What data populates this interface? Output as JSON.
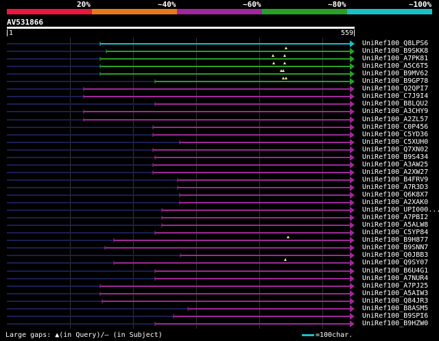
{
  "legend": {
    "items": [
      {
        "label": "20%",
        "color": "#e8193c"
      },
      {
        "label": "~40%",
        "color": "#e8781e"
      },
      {
        "label": "~60%",
        "color": "#a0289a"
      },
      {
        "label": "~80%",
        "color": "#28a028"
      },
      {
        "label": "~100%",
        "color": "#19c0c8"
      }
    ]
  },
  "query": {
    "id": "AV531866",
    "start": "1",
    "end": "559"
  },
  "hits": [
    {
      "name": "UniRef100_Q8LPS6",
      "color": "#19c0c8",
      "start": 146,
      "end": 517,
      "gap_marks": []
    },
    {
      "name": "UniRef100_B9SKK8",
      "color": "#28a028",
      "start": 155,
      "end": 517,
      "gap_marks": [
        417
      ]
    },
    {
      "name": "UniRef100_A7PK81",
      "color": "#28a028",
      "start": 146,
      "end": 517,
      "gap_marks": [
        398,
        415
      ]
    },
    {
      "name": "UniRef100_A5C6T5",
      "color": "#28a028",
      "start": 146,
      "end": 517,
      "gap_marks": [
        399,
        415
      ]
    },
    {
      "name": "UniRef100_B9MV62",
      "color": "#28a028",
      "start": 146,
      "end": 517,
      "gap_marks": [
        410,
        413
      ]
    },
    {
      "name": "UniRef100_B9GP78",
      "color": "#28a028",
      "start": 226,
      "end": 517,
      "gap_marks": [
        413,
        417
      ]
    },
    {
      "name": "UniRef100_Q2QPI7",
      "color": "#a0289a",
      "start": 122,
      "end": 517,
      "gap_marks": []
    },
    {
      "name": "UniRef100_C7J9I4",
      "color": "#a0289a",
      "start": 122,
      "end": 517,
      "gap_marks": []
    },
    {
      "name": "UniRef100_B8LQU2",
      "color": "#a0289a",
      "start": 226,
      "end": 517,
      "gap_marks": []
    },
    {
      "name": "UniRef100_A3CHY9",
      "color": "#a0289a",
      "start": 122,
      "end": 517,
      "gap_marks": []
    },
    {
      "name": "UniRef100_A2ZL57",
      "color": "#a0289a",
      "start": 122,
      "end": 517,
      "gap_marks": []
    },
    {
      "name": "UniRef100_C0P456",
      "color": "#a0289a",
      "start": 223,
      "end": 517,
      "gap_marks": []
    },
    {
      "name": "UniRef100_C5YD36",
      "color": "#a0289a",
      "start": 223,
      "end": 517,
      "gap_marks": []
    },
    {
      "name": "UniRef100_C5XUH0",
      "color": "#a0289a",
      "start": 262,
      "end": 517,
      "gap_marks": []
    },
    {
      "name": "UniRef100_Q7XN02",
      "color": "#a0289a",
      "start": 223,
      "end": 517,
      "gap_marks": []
    },
    {
      "name": "UniRef100_B9S434",
      "color": "#a0289a",
      "start": 226,
      "end": 517,
      "gap_marks": []
    },
    {
      "name": "UniRef100_A3AW25",
      "color": "#a0289a",
      "start": 223,
      "end": 517,
      "gap_marks": []
    },
    {
      "name": "UniRef100_A2XW27",
      "color": "#a0289a",
      "start": 223,
      "end": 517,
      "gap_marks": []
    },
    {
      "name": "UniRef100_B4FRV9",
      "color": "#a0289a",
      "start": 259,
      "end": 517,
      "gap_marks": []
    },
    {
      "name": "UniRef100_A7R3D3",
      "color": "#a0289a",
      "start": 259,
      "end": 517,
      "gap_marks": []
    },
    {
      "name": "UniRef100_Q6K8X7",
      "color": "#a0289a",
      "start": 262,
      "end": 517,
      "gap_marks": []
    },
    {
      "name": "UniRef100_A2XAK0",
      "color": "#a0289a",
      "start": 262,
      "end": 517,
      "gap_marks": []
    },
    {
      "name": "UniRef100_UPI000...",
      "color": "#a0289a",
      "start": 236,
      "end": 517,
      "gap_marks": []
    },
    {
      "name": "UniRef100_A7PBI2",
      "color": "#a0289a",
      "start": 236,
      "end": 517,
      "gap_marks": []
    },
    {
      "name": "UniRef100_A5ALW8",
      "color": "#a0289a",
      "start": 236,
      "end": 517,
      "gap_marks": []
    },
    {
      "name": "UniRef100_C5YP84",
      "color": "#a0289a",
      "start": 226,
      "end": 517,
      "gap_marks": []
    },
    {
      "name": "UniRef100_B9H877",
      "color": "#a0289a",
      "start": 166,
      "end": 517,
      "gap_marks": [
        420
      ]
    },
    {
      "name": "UniRef100_B9SNN7",
      "color": "#a0289a",
      "start": 153,
      "end": 517,
      "gap_marks": []
    },
    {
      "name": "UniRef100_Q0JBB3",
      "color": "#a0289a",
      "start": 263,
      "end": 517,
      "gap_marks": []
    },
    {
      "name": "UniRef100_Q9SY07",
      "color": "#a0289a",
      "start": 166,
      "end": 517,
      "gap_marks": [
        416
      ]
    },
    {
      "name": "UniRef100_B6U4G1",
      "color": "#a0289a",
      "start": 226,
      "end": 517,
      "gap_marks": []
    },
    {
      "name": "UniRef100_A7NUR4",
      "color": "#a0289a",
      "start": 226,
      "end": 517,
      "gap_marks": []
    },
    {
      "name": "UniRef100_A7PJ25",
      "color": "#a0289a",
      "start": 146,
      "end": 517,
      "gap_marks": []
    },
    {
      "name": "UniRef100_A5AIW3",
      "color": "#a0289a",
      "start": 146,
      "end": 517,
      "gap_marks": []
    },
    {
      "name": "UniRef100_Q84JR3",
      "color": "#a0289a",
      "start": 149,
      "end": 517,
      "gap_marks": []
    },
    {
      "name": "UniRef100_B8ASM5",
      "color": "#a0289a",
      "start": 274,
      "end": 517,
      "gap_marks": []
    },
    {
      "name": "UniRef100_B9SPI6",
      "color": "#a0289a",
      "start": 253,
      "end": 517,
      "gap_marks": []
    },
    {
      "name": "UniRef100_B9HZW0",
      "color": "#a0289a",
      "start": 226,
      "end": 517,
      "gap_marks": []
    }
  ],
  "footer": {
    "gaps_label": "Large gaps: ▲(in Query)/‒ (in Subject)",
    "scale_label": "=100char."
  }
}
